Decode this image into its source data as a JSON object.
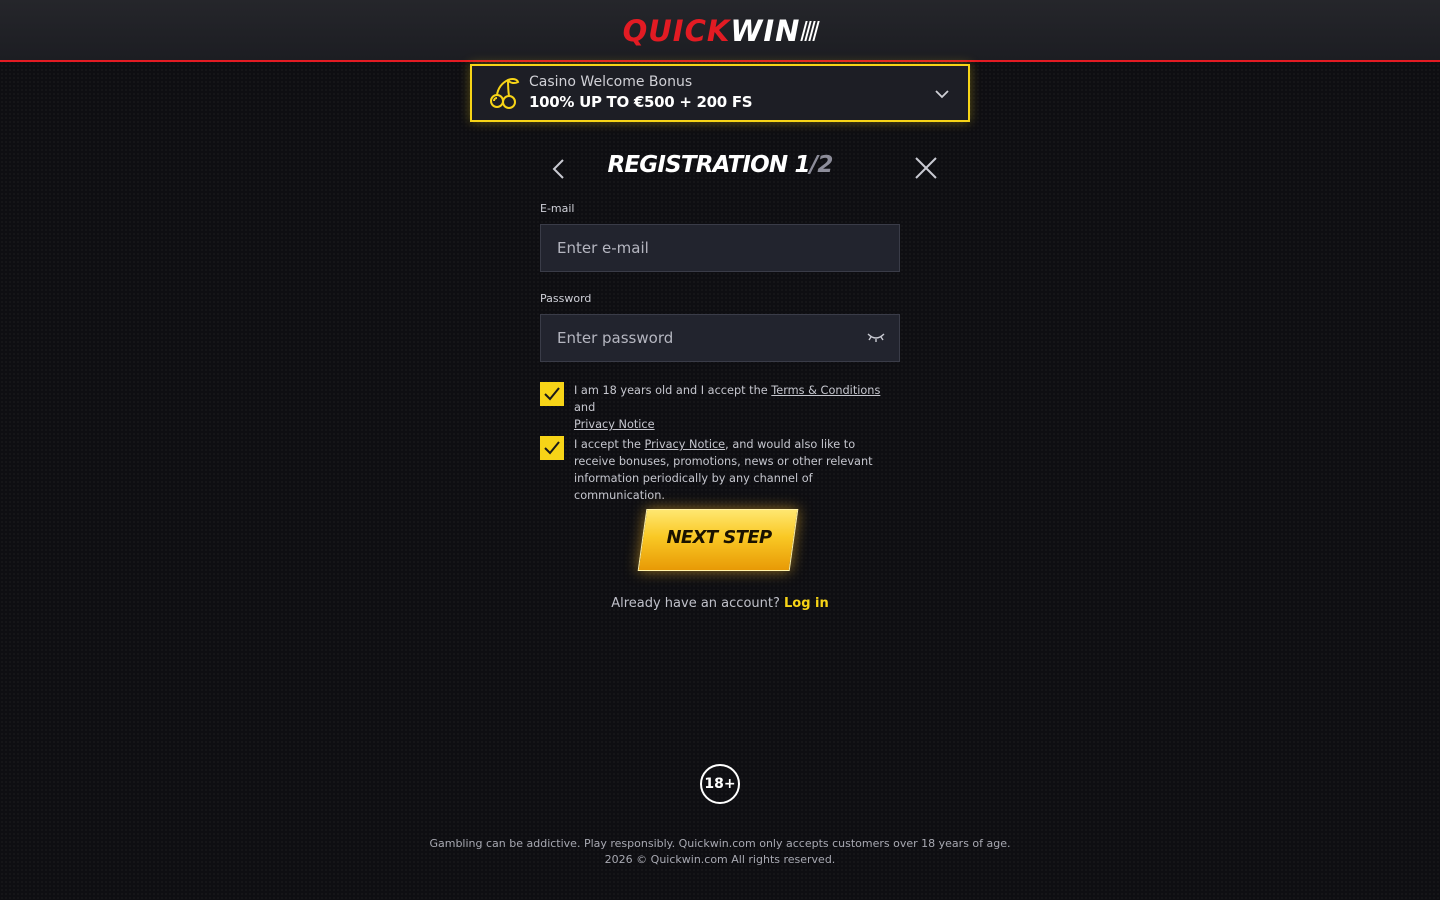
{
  "header": {
    "logo_quick": "QUICK",
    "logo_win": "WIN"
  },
  "bonus": {
    "subtitle": "Casino Welcome Bonus",
    "title": "100% UP TO €500 + 200 FS",
    "icon": "cherry-icon",
    "accent_color": "#f7d417"
  },
  "registration": {
    "title": "REGISTRATION",
    "step_current": "1",
    "step_total": "/2"
  },
  "form": {
    "email_label": "E-mail",
    "email_placeholder": "Enter e-mail",
    "email_value": "",
    "password_label": "Password",
    "password_placeholder": "Enter password",
    "password_value": ""
  },
  "consents": [
    {
      "checked": true,
      "text_before": "I am 18 years old and I accept the ",
      "link1": "Terms & Conditions",
      "text_middle": " and",
      "link2": "Privacy Notice",
      "text_after": ""
    },
    {
      "checked": true,
      "text_before": "I accept the ",
      "link1": "Privacy Notice",
      "text_after": ", and would also like to receive bonuses, promotions, news or other relevant information periodically by any channel of communication."
    }
  ],
  "actions": {
    "next_step": "NEXT STEP",
    "already_text": "Already have an account?",
    "login_link": "Log in"
  },
  "footer": {
    "age_badge": "18+",
    "line1": "Gambling can be addictive. Play responsibly. Quickwin.com only accepts customers over 18 years of age.",
    "line2": "2026 © Quickwin.com All rights reserved."
  },
  "colors": {
    "brand_red": "#e31b23",
    "accent_yellow": "#f7d417",
    "background": "#0e0e12"
  }
}
